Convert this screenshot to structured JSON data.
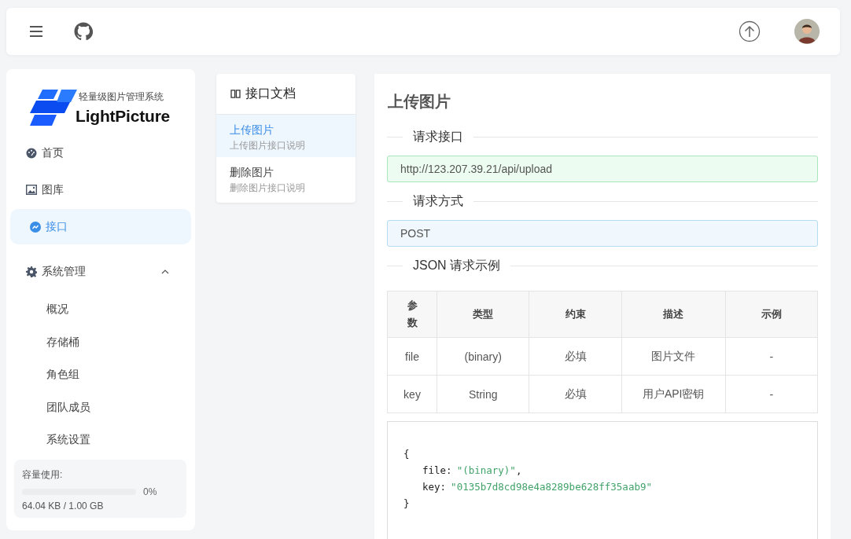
{
  "sidebar": {
    "logo": {
      "subtitle": "轻量级图片管理系统",
      "name": "LightPicture"
    },
    "items": [
      {
        "kind": "link",
        "label": "首页",
        "selected": false
      },
      {
        "kind": "link",
        "label": "图库",
        "selected": false
      },
      {
        "kind": "link",
        "label": "接口",
        "selected": true
      },
      {
        "kind": "group",
        "label": "系统管理",
        "selected": false,
        "expanded": true,
        "children": [
          {
            "label": "概况"
          },
          {
            "label": "存储桶"
          },
          {
            "label": "角色组"
          },
          {
            "label": "团队成员"
          },
          {
            "label": "系统设置"
          }
        ]
      }
    ],
    "storage": {
      "label": "容量使用:",
      "level": 0,
      "percent": "0%",
      "usage": "64.04 KB / 1.00 GB"
    }
  },
  "doc_nav": {
    "title": "接口文档",
    "items": [
      {
        "title": "上传图片",
        "desc": "上传图片接口说明",
        "selected": true
      },
      {
        "title": "删除图片",
        "desc": "删除图片接口说明",
        "selected": false
      }
    ]
  },
  "main": {
    "title": "上传图片",
    "endpoint": {
      "heading": "请求接口",
      "value": "http://123.207.39.21/api/upload"
    },
    "method": {
      "heading": "请求方式",
      "value": "POST"
    },
    "example": {
      "heading": "JSON 请求示例"
    },
    "table": {
      "columns": [
        "参数",
        "类型",
        "约束",
        "描述",
        "示例"
      ],
      "rows": [
        [
          "file",
          "(binary)",
          "必填",
          "图片文件",
          "-"
        ],
        [
          "key",
          "String",
          "必填",
          "用户API密钥",
          "-"
        ]
      ]
    },
    "code": {
      "open": "{",
      "lines": [
        {
          "key": "file:",
          "value": "\"(binary)\"",
          "suffix": ","
        },
        {
          "key": "key:",
          "value": "\"0135b7d8cd98e4a8289be628ff35aab9\""
        }
      ],
      "close": "}"
    }
  }
}
